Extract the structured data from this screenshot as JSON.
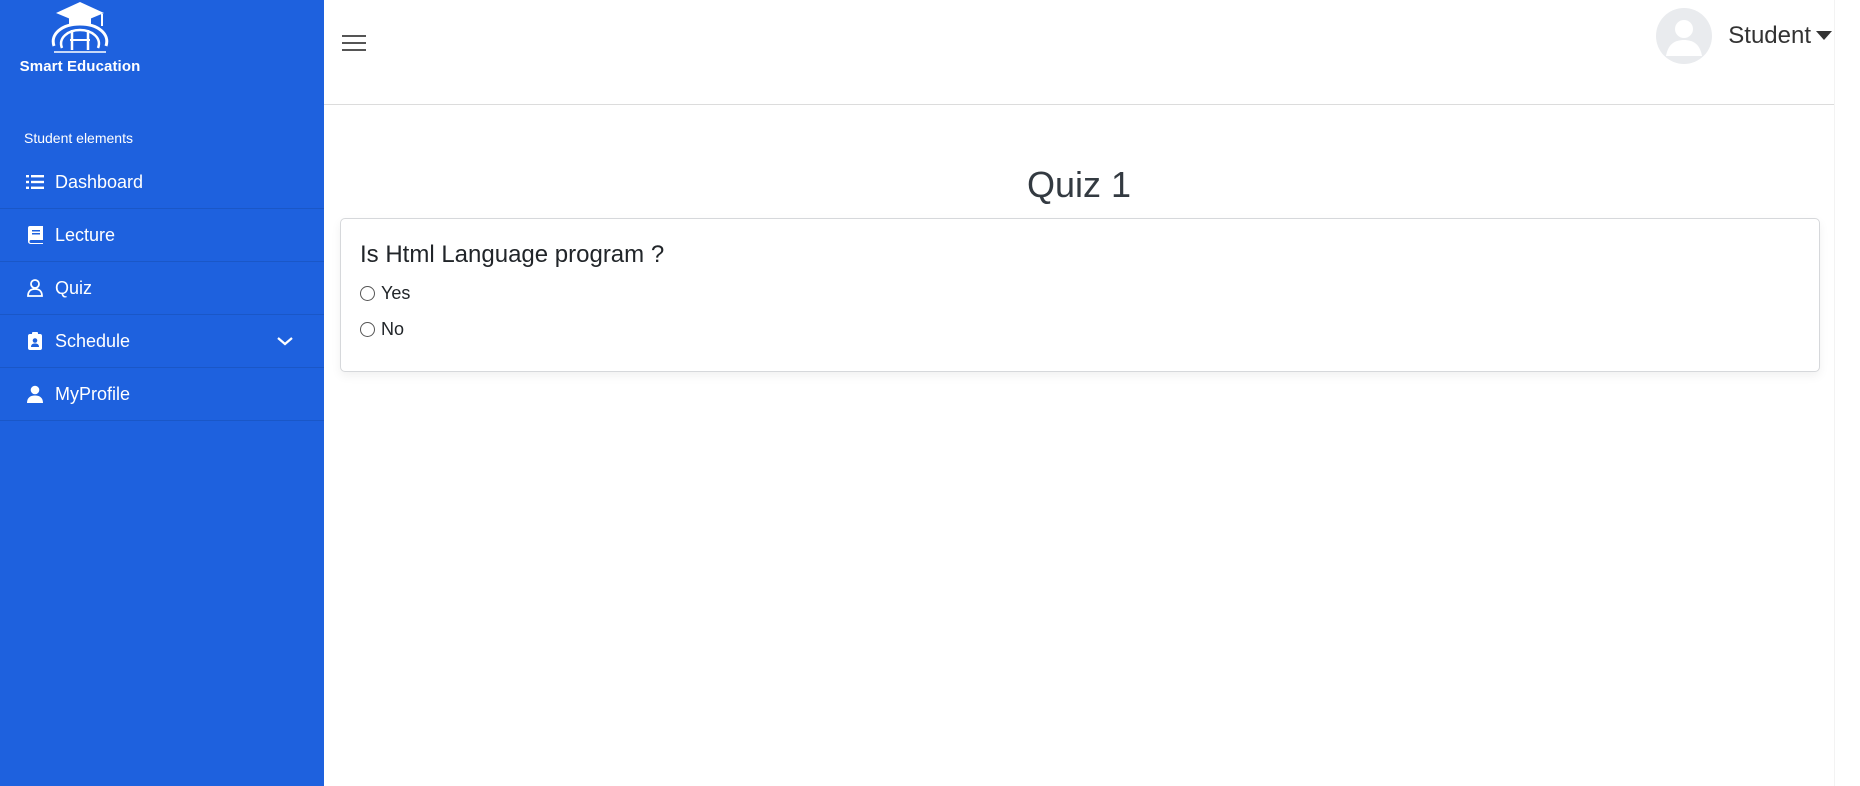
{
  "brand": {
    "name": "Smart Education",
    "logo_icon": "graduation-cap-globe-icon"
  },
  "sidebar": {
    "section_label": "Student elements",
    "items": [
      {
        "label": "Dashboard",
        "icon": "list-icon"
      },
      {
        "label": "Lecture",
        "icon": "book-icon"
      },
      {
        "label": "Quiz",
        "icon": "user-outline-icon"
      },
      {
        "label": "Schedule",
        "icon": "clipboard-user-icon",
        "expandable": true
      },
      {
        "label": "MyProfile",
        "icon": "user-solid-icon"
      }
    ]
  },
  "header": {
    "user_name": "Student"
  },
  "main": {
    "title": "Quiz 1",
    "question": "Is Html Language program ?",
    "options": [
      "Yes",
      "No"
    ]
  },
  "colors": {
    "sidebar": "#1e61de",
    "text": "#212529"
  }
}
